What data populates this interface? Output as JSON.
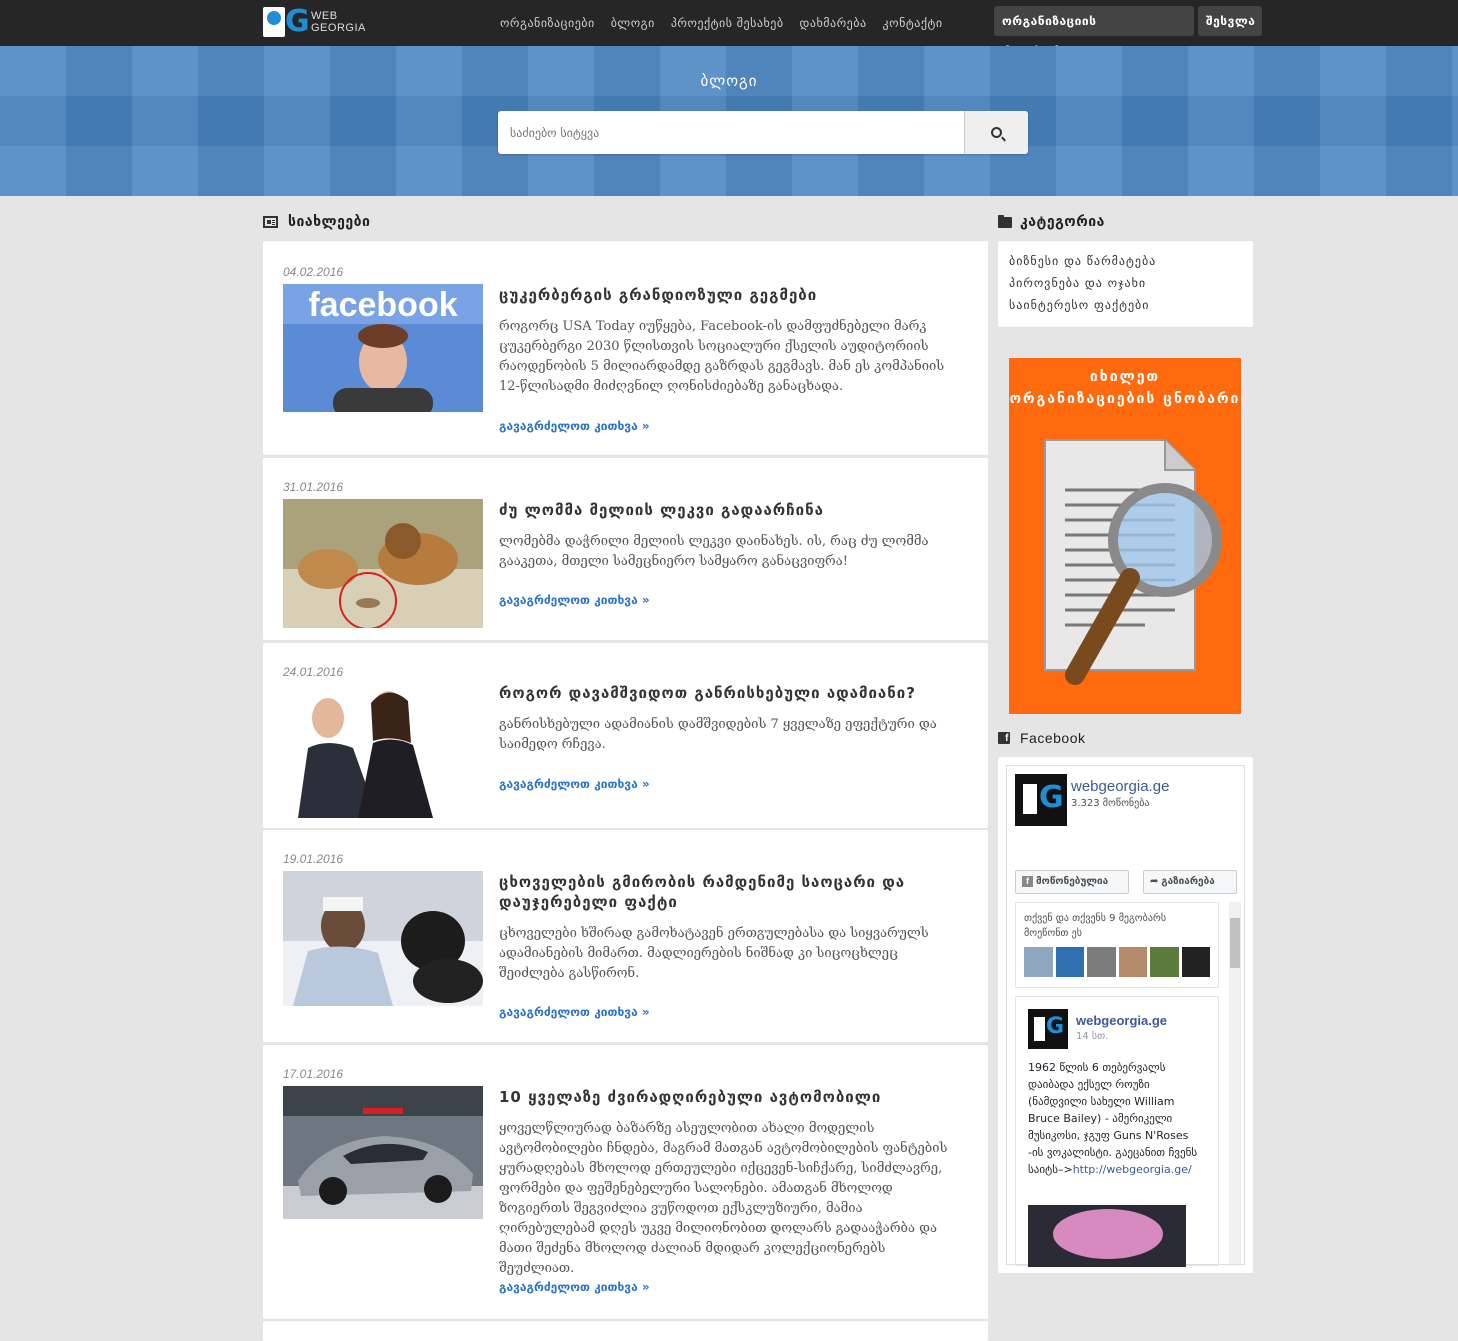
{
  "header": {
    "logo_text_line1": "WEB",
    "logo_text_line2": "GEORGIA",
    "nav": [
      "ორგანიზაციები",
      "ბლოგი",
      "პროექტის შესახებ",
      "დახმარება",
      "კონტაქტი"
    ],
    "register_label": "ორგანიზაციის რეგისტრაცია",
    "login_label": "შესვლა"
  },
  "hero": {
    "title": "ბლოგი",
    "search_placeholder": "საძიებო სიტყვა"
  },
  "main": {
    "section_title": "სიახლეები",
    "read_more_label": "გავაგრძელოთ კითხვა »",
    "posts": [
      {
        "date": "04.02.2016",
        "title": "ცუკერბერგის გრანდიოზული გეგმები",
        "body": "როგორც USA Today იუწყება, Facebook-ის დამფუძნებელი მარკ ცუკერბერგი 2030 წლისთვის სოციალური ქსელის აუდიტორიის რაოდენობის 5 მილიარდამდე გაზრდას გეგმავს.  მან ეს კომპანიის 12-წლისადმი მიძღვნილ ღონისძიებაზე განაცხადა.",
        "thumb": "facebook"
      },
      {
        "date": "31.01.2016",
        "title": "ძუ ლომმა მელიის ლეკვი გადაარჩინა",
        "body": "ლომებმა დაჭრილი მელიის ლეკვი დაინახეს. ის, რაც ძუ ლომმა გააკეთა, მთელი სამეცნიერო სამყარო განაცვიფრა!",
        "thumb": "lions"
      },
      {
        "date": "24.01.2016",
        "title": "როგორ დავამშვიდოთ განრისხებული ადამიანი?",
        "body": "განრისხებული ადამიანის დამშვიდების 7 ყველაზე ეფექტური და საიმედო რჩევა.",
        "thumb": "people"
      },
      {
        "date": "19.01.2016",
        "title": "ცხოველების გმირობის რამდენიმე საოცარი და დაუჯერებელი ფაქტი",
        "body": "ცხოველები ხშირად გამოხატავენ ერთგულებასა და სიყვარულს ადამიანების მიმართ. მადლიერების ნიშნად კი სიცოცხლეც  შეიძლება გასწირონ.",
        "thumb": "dog"
      },
      {
        "date": "17.01.2016",
        "title": "10 ყველაზე ძვირადღირებული ავტომობილი",
        "body": "ყოველწლიურად ბაზარზე ასეულობით ახალი მოდელის ავტომობილები ჩნდება, მაგრამ მათგან ავტომობილების ფანტების ყურადღებას მხოლოდ ერთეულები იქცევენ-სიჩქარე, სიმძლავრე, ფორმები და ფეშენებელური სალონები. ამათგან მხოლოდ ზოგიერთს შეგვიძლია ვუწოდოთ ექსკლუზიური, მამია ღირებულებამ დღეს უკვე მილიონობით დოლარს გადააჭარბა და მათი შეძენა მხოლოდ ძალიან მდიდარ კოლექციონერებს შეუძლიათ.",
        "thumb": "car"
      }
    ]
  },
  "sidebar": {
    "category_title": "კატეგორია",
    "categories": [
      "ბიზნესი და წარმატება",
      "პიროვნება და ოჯახი",
      "საინტერესო ფაქტები"
    ],
    "ad_line1": "იხილეთ",
    "ad_line2": "ორგანიზაციების ცნობარი",
    "facebook_title": "Facebook",
    "fb": {
      "page_name": "webgeorgia.ge",
      "likes": "3.323 მოწონება",
      "liked_btn": "მოწონებულია",
      "share_btn": "გაზიარება",
      "friends_text": "თქვენ და თქვენს 9 მეგობარს მოეწონთ ეს",
      "post_name": "webgeorgia.ge",
      "post_time": "14 სთ.",
      "post_text": "1962 წლის 6 თებერვალს დაიბადა ექსელ როუზი (ნამდვილი სახელი William Bruce Bailey) - ამერიკელი მუსიკოსი, ჯგუფ Guns N'Roses -ის ვოკალისტი. გაეცანით ჩვენს საიტს–>",
      "post_link": "http://webgeorgia.ge/"
    }
  },
  "colors": {
    "accent": "#2a73c7",
    "topbar": "#262626",
    "hero": "#4a86c2",
    "ad": "#ff6a0f",
    "fb": "#3b5998"
  }
}
